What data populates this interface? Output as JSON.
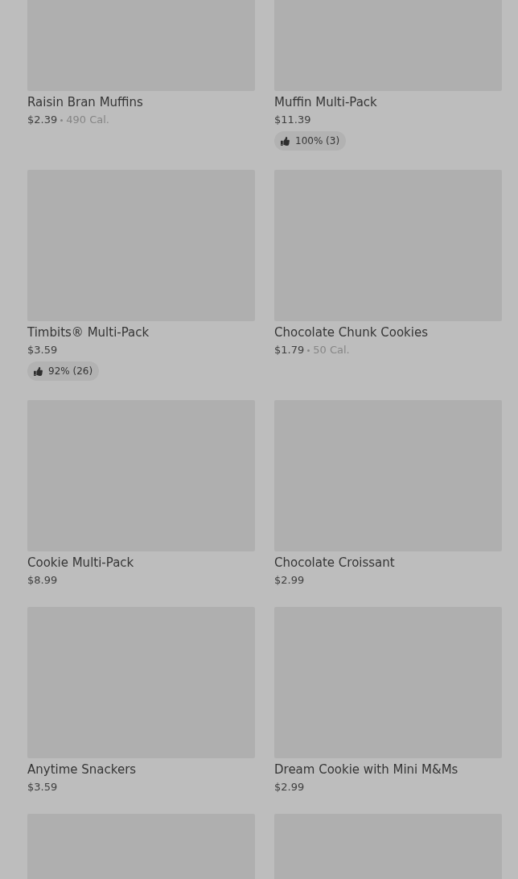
{
  "products": [
    {
      "kind": "product",
      "name": "Raisin Bran Muffins",
      "price": "$2.39",
      "calories": "490 Cal."
    },
    {
      "kind": "product",
      "name": "Muffin Multi-Pack",
      "price": "$11.39",
      "rating": "100% (3)"
    },
    {
      "kind": "product",
      "name": "Timbits® Multi-Pack",
      "price": "$3.59",
      "rating": "92% (26)"
    },
    {
      "kind": "product",
      "name": "Chocolate Chunk Cookies",
      "price": "$1.79",
      "calories": "50 Cal."
    },
    {
      "kind": "product",
      "name": "Cookie Multi-Pack",
      "price": "$8.99"
    },
    {
      "kind": "product",
      "name": "Chocolate Croissant",
      "price": "$2.99"
    },
    {
      "kind": "product",
      "name": "Anytime Snackers",
      "price": "$3.59"
    },
    {
      "kind": "product",
      "name": "Dream Cookie with Mini M&Ms",
      "price": "$2.99"
    },
    {
      "kind": "image-only"
    },
    {
      "kind": "image-only"
    }
  ]
}
